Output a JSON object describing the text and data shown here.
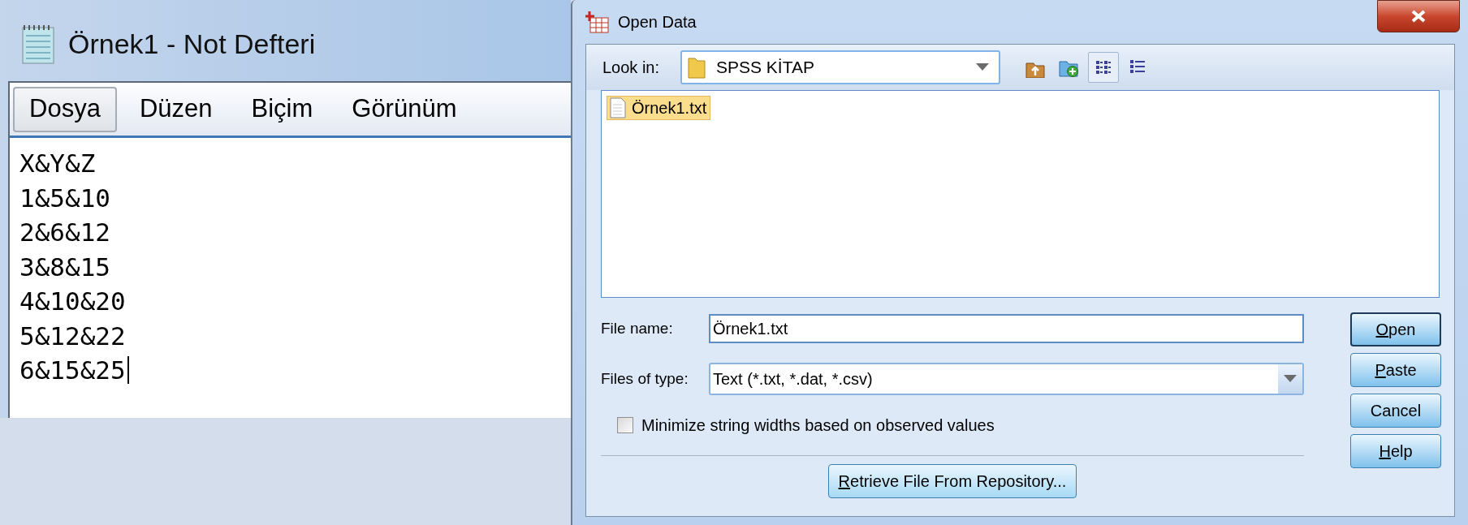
{
  "notepad": {
    "title": "Örnek1 - Not Defteri",
    "menu": [
      {
        "label": "Dosya",
        "selected": true
      },
      {
        "label": "Düzen",
        "selected": false
      },
      {
        "label": "Biçim",
        "selected": false
      },
      {
        "label": "Görünüm",
        "selected": false
      }
    ],
    "lines": [
      "X&Y&Z",
      "1&5&10",
      "2&6&12",
      "3&8&15",
      "4&10&20",
      "5&12&22",
      "6&15&25"
    ]
  },
  "dialog": {
    "title": "Open Data",
    "look_in": {
      "label": "Look in:",
      "value": "SPSS KİTAP"
    },
    "view_buttons": [
      {
        "kind": "up",
        "selected": false
      },
      {
        "kind": "new-folder",
        "selected": false
      },
      {
        "kind": "list",
        "selected": true
      },
      {
        "kind": "details",
        "selected": false
      }
    ],
    "files": [
      {
        "name": "Örnek1.txt",
        "selected": true
      }
    ],
    "file_name": {
      "label": "File name:",
      "value": "Örnek1.txt"
    },
    "file_type": {
      "label": "Files of type:",
      "value": "Text (*.txt, *.dat, *.csv)"
    },
    "minimize": {
      "label": "Minimize string widths based on observed values",
      "checked": false
    },
    "retrieve_button": {
      "label": "Retrieve File From Repository...",
      "first_letter_underlined": true
    },
    "buttons": [
      {
        "label": "Open",
        "first_letter_underlined": true,
        "default": true
      },
      {
        "label": "Paste",
        "first_letter_underlined": true,
        "default": false
      },
      {
        "label": "Cancel",
        "first_letter_underlined": false,
        "default": false
      },
      {
        "label": "Help",
        "first_letter_underlined": true,
        "default": false
      }
    ]
  }
}
